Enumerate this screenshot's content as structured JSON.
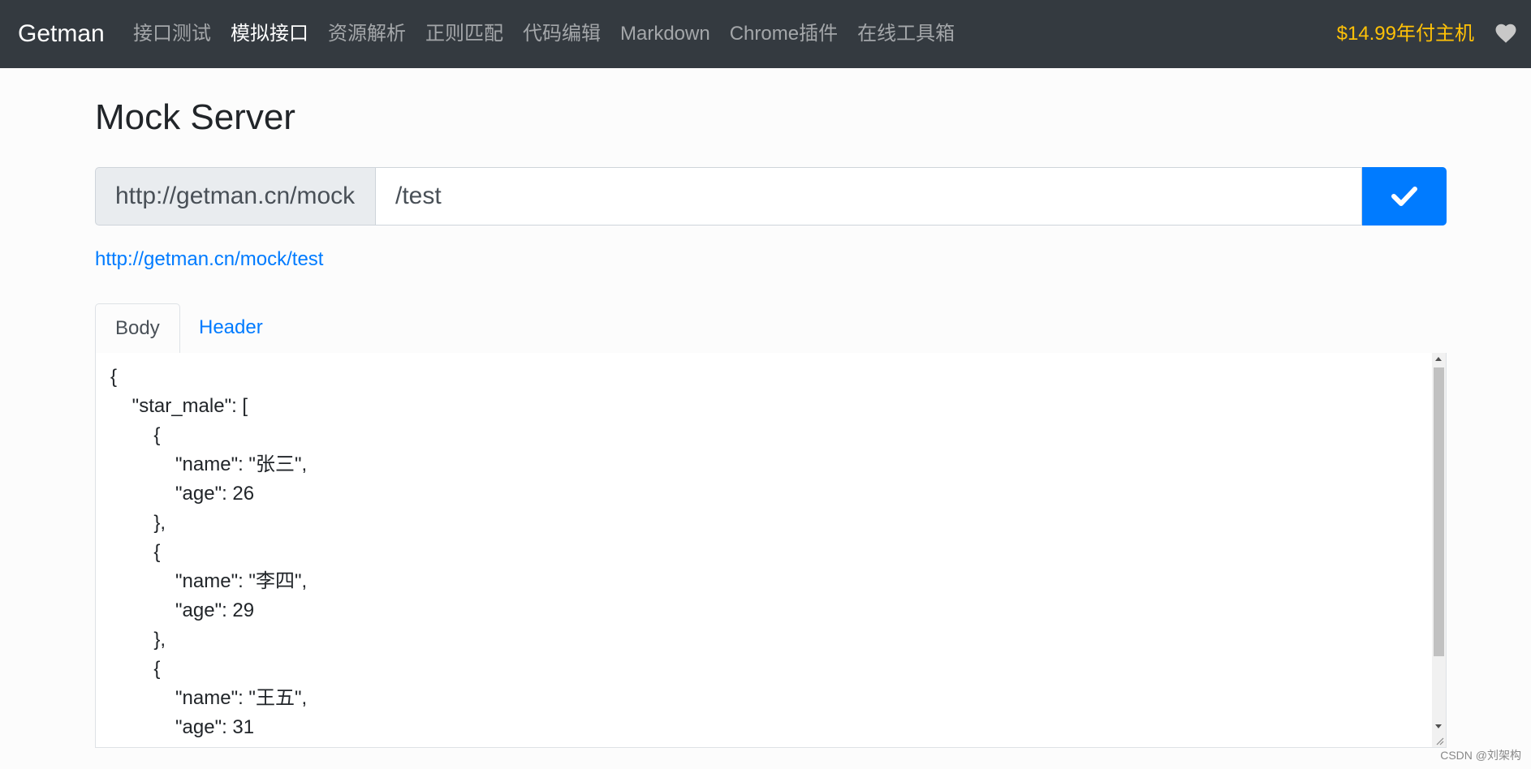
{
  "navbar": {
    "brand": "Getman",
    "items": [
      {
        "label": "接口测试",
        "active": false
      },
      {
        "label": "模拟接口",
        "active": true
      },
      {
        "label": "资源解析",
        "active": false
      },
      {
        "label": "正则匹配",
        "active": false
      },
      {
        "label": "代码编辑",
        "active": false
      },
      {
        "label": "Markdown",
        "active": false
      },
      {
        "label": "Chrome插件",
        "active": false
      },
      {
        "label": "在线工具箱",
        "active": false
      }
    ],
    "promo": "$14.99年付主机",
    "icon": "heart-icon"
  },
  "main": {
    "title": "Mock Server",
    "url_prefix": "http://getman.cn/mock",
    "path_value": "/test",
    "submit_icon": "check-icon",
    "result_link": "http://getman.cn/mock/test",
    "tabs": [
      {
        "label": "Body",
        "active": true
      },
      {
        "label": "Header",
        "active": false
      }
    ],
    "body_text": "{\n    \"star_male\": [\n        {\n            \"name\": \"张三\",\n            \"age\": 26\n        },\n        {\n            \"name\": \"李四\",\n            \"age\": 29\n        },\n        {\n            \"name\": \"王五\",\n            \"age\": 31"
  },
  "watermark": "CSDN @刘架构",
  "colors": {
    "navbar_bg": "#343a40",
    "primary": "#007bff",
    "promo": "#ffc107"
  }
}
